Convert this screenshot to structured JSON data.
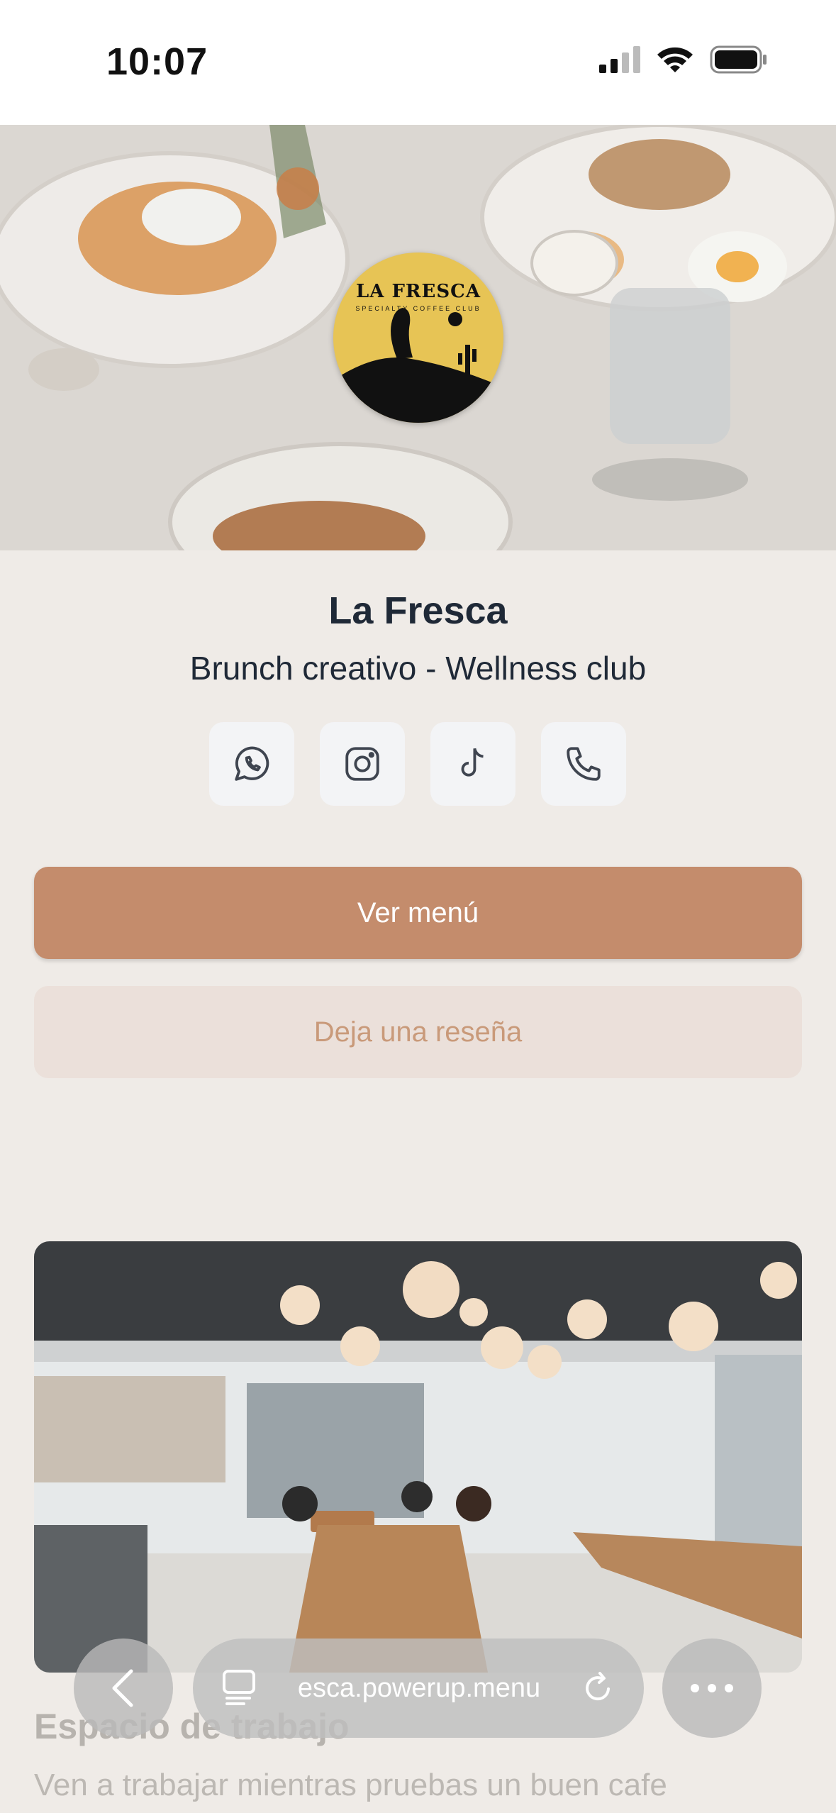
{
  "status_bar": {
    "time": "10:07"
  },
  "logo": {
    "title": "LA FRESCA",
    "subtitle": "SPECIALTY COFFEE CLUB"
  },
  "profile": {
    "name": "La Fresca",
    "tagline": "Brunch creativo - Wellness club"
  },
  "socials": [
    {
      "name": "whatsapp-icon"
    },
    {
      "name": "instagram-icon"
    },
    {
      "name": "tiktok-icon"
    },
    {
      "name": "phone-icon"
    }
  ],
  "actions": {
    "menu_label": "Ver menú",
    "review_label": "Deja una reseña"
  },
  "card": {
    "title": "Espacio de trabajo",
    "description": "Ven a trabajar mientras pruebas un buen cafe"
  },
  "browser": {
    "url": "esca.powerup.menu"
  },
  "colors": {
    "primary": "#c48c6c",
    "secondary_bg": "#ebe0da",
    "page_bg": "#efebe7"
  }
}
